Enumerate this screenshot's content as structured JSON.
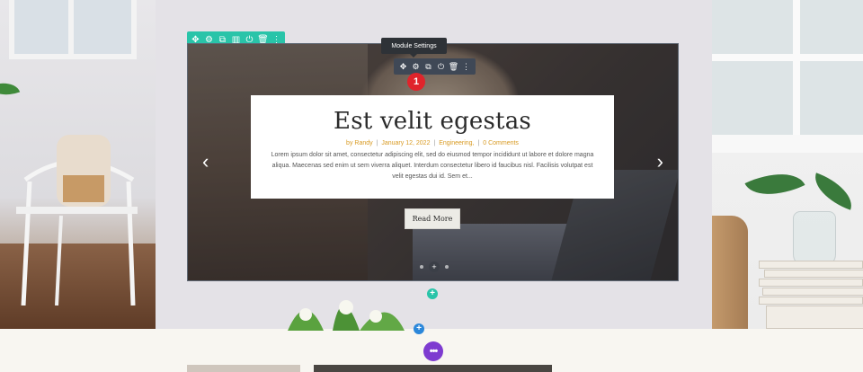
{
  "section_toolbar": {
    "icons": [
      "move-icon",
      "gear-icon",
      "duplicate-icon",
      "columns-icon",
      "power-icon",
      "trash-icon",
      "more-icon"
    ],
    "color": "#29c4a9"
  },
  "module_toolbar": {
    "tooltip": "Module Settings",
    "icons": [
      "move-icon",
      "gear-icon",
      "duplicate-icon",
      "power-icon",
      "trash-icon",
      "more-icon"
    ],
    "color": "#3f4856"
  },
  "step_badge": "1",
  "slide": {
    "title": "Est velit egestas",
    "meta": {
      "author": "by Randy",
      "date": "January 12, 2022",
      "category": "Engineering,",
      "comments": "0 Comments",
      "separator": "|"
    },
    "excerpt": "Lorem ipsum dolor sit amet, consectetur adipiscing elit, sed do eiusmod tempor incididunt ut labore et dolore magna aliqua. Maecenas sed enim ut sem viverra aliquet. Interdum consectetur libero id faucibus nisl. Facilisis volutpat est velit egestas dui id. Sem et...",
    "button_label": "Read More",
    "prev_arrow": "‹",
    "next_arrow": "›",
    "accent": "#d89a22"
  },
  "add_buttons": {
    "row": "+",
    "section": "+",
    "page_settings": "•••"
  },
  "colors": {
    "row_add": "#29c4a9",
    "section_add": "#2b87da",
    "page_settings": "#7e3bd0",
    "badge": "#e0242b"
  }
}
